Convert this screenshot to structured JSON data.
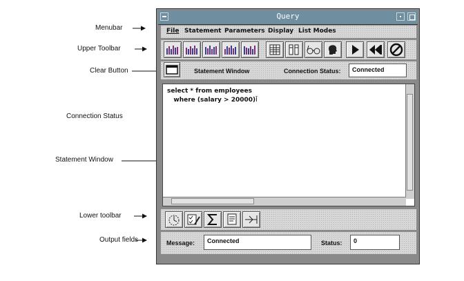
{
  "annotations": {
    "menubar": "Menubar",
    "upper_toolbar": "Upper Toolbar",
    "clear_button": "Clear Button",
    "connection_status": "Connection Status",
    "statement_window": "Statement Window",
    "lower_toolbar": "Lower toolbar",
    "output_fields": "Output fields"
  },
  "window": {
    "title": "Query"
  },
  "menus": [
    "File",
    "Statement",
    "Parameters",
    "Display",
    "List Modes"
  ],
  "upper_toolbar": {
    "buttons": [
      "chart-icon",
      "chart-icon",
      "chart-icon",
      "chart-icon",
      "chart-icon",
      "table-icon",
      "columns-icon",
      "glasses-icon",
      "head-icon",
      "play-icon",
      "rewind-icon",
      "stop-icon"
    ]
  },
  "status_row": {
    "statement_window_label": "Statement Window",
    "connection_status_label": "Connection Status:",
    "connection_status_value": "Connected"
  },
  "editor": {
    "line1": "select * from employees",
    "line2": "   where (salary > 20000)"
  },
  "lower_toolbar": {
    "buttons": [
      "stopwatch-icon",
      "checklist-icon",
      "sigma-icon",
      "document-icon",
      "arrow-join-icon"
    ]
  },
  "output": {
    "message_label": "Message:",
    "message_value": "Connected",
    "status_label": "Status:",
    "status_value": "0"
  },
  "colors": {
    "titlebar": "#6f8fa1",
    "chart_bars": [
      "#3b3b8f",
      "#7a2f7a",
      "#2a2a2a"
    ]
  }
}
